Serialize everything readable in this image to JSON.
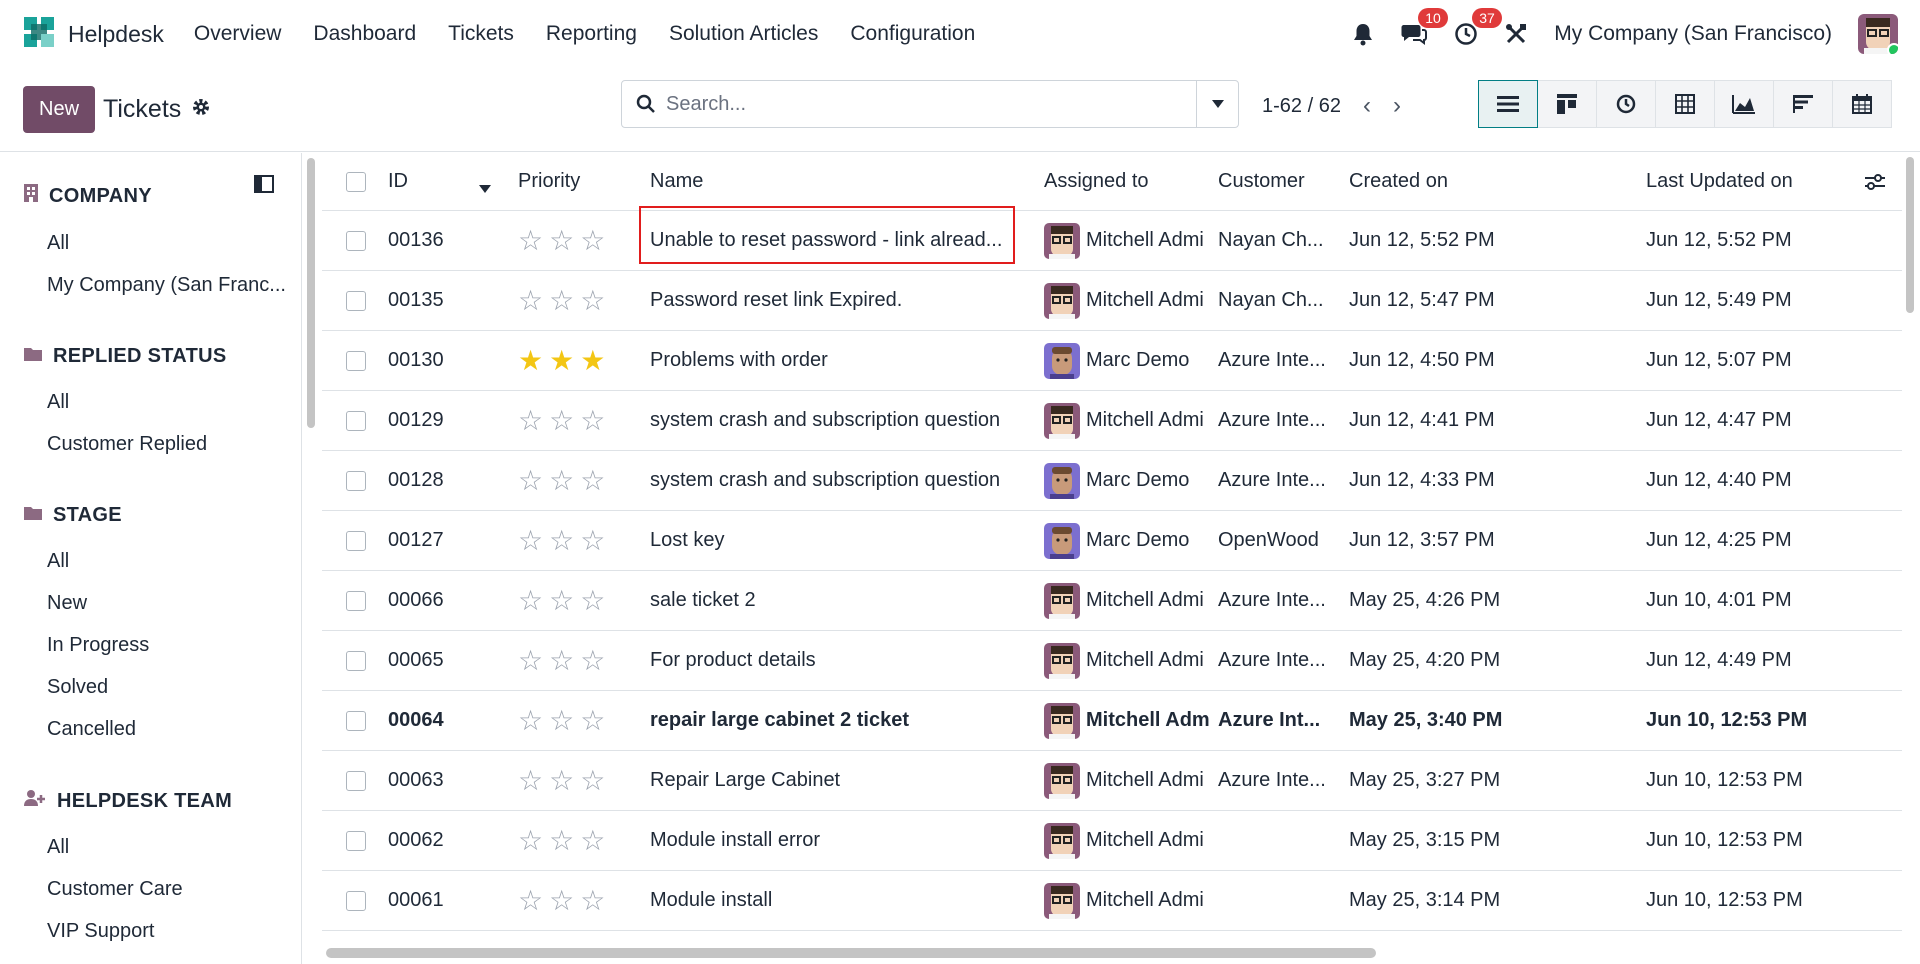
{
  "app": {
    "name": "Helpdesk"
  },
  "nav": {
    "items": [
      "Overview",
      "Dashboard",
      "Tickets",
      "Reporting",
      "Solution Articles",
      "Configuration"
    ]
  },
  "systray": {
    "messages_count": "10",
    "activity_count": "37",
    "company": "My Company (San Francisco)"
  },
  "control": {
    "new_label": "New",
    "title": "Tickets",
    "search_placeholder": "Search...",
    "pager": "1-62 / 62",
    "views": [
      "list-view-icon",
      "kanban-view-icon",
      "activity-view-icon",
      "pivot-view-icon",
      "graph-view-icon",
      "cohort-view-icon",
      "calendar-view-icon"
    ]
  },
  "sidebar": {
    "company": {
      "title": "COMPANY",
      "items": [
        "All",
        "My Company (San Franc..."
      ]
    },
    "replied": {
      "title": "REPLIED STATUS",
      "items": [
        "All",
        "Customer Replied"
      ]
    },
    "stage": {
      "title": "STAGE",
      "items": [
        "All",
        "New",
        "In Progress",
        "Solved",
        "Cancelled"
      ]
    },
    "team": {
      "title": "HELPDESK TEAM",
      "items": [
        "All",
        "Customer Care",
        "VIP Support"
      ]
    }
  },
  "table": {
    "columns": {
      "id": "ID",
      "priority": "Priority",
      "name": "Name",
      "assigned": "Assigned to",
      "customer": "Customer",
      "created": "Created on",
      "updated": "Last Updated on"
    },
    "rows": [
      {
        "id": "00136",
        "stars": 0,
        "name": "Unable to reset password - link alread...",
        "assigned": "Mitchell Admi",
        "avatar": "mitchell",
        "customer": "Nayan Ch...",
        "created": "Jun 12, 5:52 PM",
        "updated": "Jun 12, 5:52 PM",
        "bold": false
      },
      {
        "id": "00135",
        "stars": 0,
        "name": "Password reset link Expired.",
        "assigned": "Mitchell Admi",
        "avatar": "mitchell",
        "customer": "Nayan Ch...",
        "created": "Jun 12, 5:47 PM",
        "updated": "Jun 12, 5:49 PM",
        "bold": false
      },
      {
        "id": "00130",
        "stars": 3,
        "name": "Problems with order",
        "assigned": "Marc Demo",
        "avatar": "marc",
        "customer": "Azure Inte...",
        "created": "Jun 12, 4:50 PM",
        "updated": "Jun 12, 5:07 PM",
        "bold": false
      },
      {
        "id": "00129",
        "stars": 0,
        "name": "system crash and subscription question",
        "assigned": "Mitchell Admi",
        "avatar": "mitchell",
        "customer": "Azure Inte...",
        "created": "Jun 12, 4:41 PM",
        "updated": "Jun 12, 4:47 PM",
        "bold": false
      },
      {
        "id": "00128",
        "stars": 0,
        "name": "system crash and subscription question",
        "assigned": "Marc Demo",
        "avatar": "marc",
        "customer": "Azure Inte...",
        "created": "Jun 12, 4:33 PM",
        "updated": "Jun 12, 4:40 PM",
        "bold": false
      },
      {
        "id": "00127",
        "stars": 0,
        "name": "Lost key",
        "assigned": "Marc Demo",
        "avatar": "marc",
        "customer": "OpenWood",
        "created": "Jun 12, 3:57 PM",
        "updated": "Jun 12, 4:25 PM",
        "bold": false
      },
      {
        "id": "00066",
        "stars": 0,
        "name": "sale ticket 2",
        "assigned": "Mitchell Admi",
        "avatar": "mitchell",
        "customer": "Azure Inte...",
        "created": "May 25, 4:26 PM",
        "updated": "Jun 10, 4:01 PM",
        "bold": false
      },
      {
        "id": "00065",
        "stars": 0,
        "name": "For product details",
        "assigned": "Mitchell Admi",
        "avatar": "mitchell",
        "customer": "Azure Inte...",
        "created": "May 25, 4:20 PM",
        "updated": "Jun 12, 4:49 PM",
        "bold": false
      },
      {
        "id": "00064",
        "stars": 0,
        "name": "repair large cabinet 2 ticket",
        "assigned": "Mitchell Adm",
        "avatar": "mitchell",
        "customer": "Azure Int...",
        "created": "May 25, 3:40 PM",
        "updated": "Jun 10, 12:53 PM",
        "bold": true
      },
      {
        "id": "00063",
        "stars": 0,
        "name": "Repair Large Cabinet",
        "assigned": "Mitchell Admi",
        "avatar": "mitchell",
        "customer": "Azure Inte...",
        "created": "May 25, 3:27 PM",
        "updated": "Jun 10, 12:53 PM",
        "bold": false
      },
      {
        "id": "00062",
        "stars": 0,
        "name": "Module install error",
        "assigned": "Mitchell Admi",
        "avatar": "mitchell",
        "customer": "",
        "created": "May 25, 3:15 PM",
        "updated": "Jun 10, 12:53 PM",
        "bold": false
      },
      {
        "id": "00061",
        "stars": 0,
        "name": "Module install",
        "assigned": "Mitchell Admi",
        "avatar": "mitchell",
        "customer": "",
        "created": "May 25, 3:14 PM",
        "updated": "Jun 10, 12:53 PM",
        "bold": false
      }
    ]
  },
  "colors": {
    "primary": "#714b67",
    "accent": "#017e84",
    "star": "#f3c614",
    "badge": "#e03a3a",
    "highlight": "#e11d1d"
  }
}
